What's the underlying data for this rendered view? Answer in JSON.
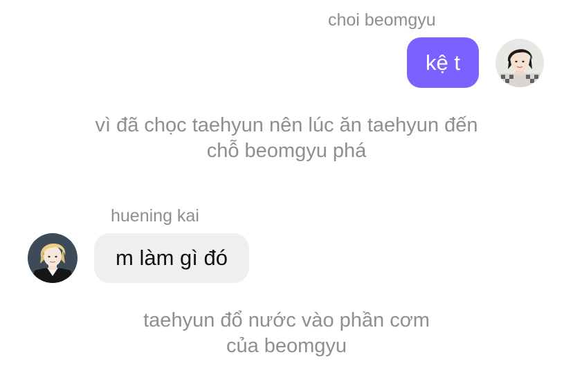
{
  "messages": {
    "beomgyu": {
      "sender": "choi beomgyu",
      "text": "kệ t",
      "avatar_icon": "avatar-beomgyu-photo"
    },
    "kai": {
      "sender": "huening kai",
      "text": "m làm gì đó",
      "avatar_icon": "avatar-huening-kai-photo"
    }
  },
  "narration": {
    "first_line1": "vì đã chọc taehyun nên lúc ăn taehyun đến",
    "first_line2": "chỗ beomgyu phá",
    "second_line1": "taehyun đổ nước vào phần cơm",
    "second_line2": "của beomgyu"
  },
  "colors": {
    "outgoing_bubble": "#7b61ff",
    "incoming_bubble": "#efeff0",
    "muted_text": "#8e8e93",
    "background": "#ffffff"
  }
}
